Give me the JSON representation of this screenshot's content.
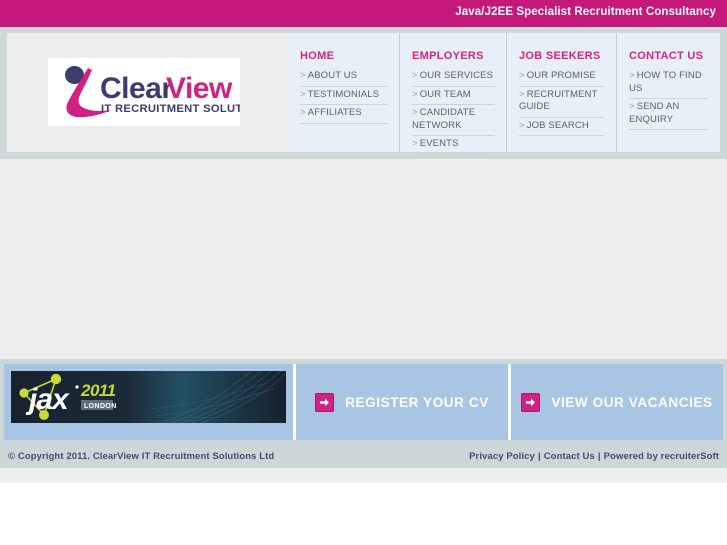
{
  "topbar": {
    "tagline": "Java/J2EE Specialist Recruitment Consultancy",
    "background_color": "#c4197a",
    "text_color": "#ffffff"
  },
  "logo": {
    "name": "clearview-logo",
    "text_clear": "Clear",
    "text_view": "View",
    "tagline": "IT RECRUITMENT SOLUTIONS",
    "color_dark": "#3c3c6e",
    "color_pink": "#cf2283"
  },
  "nav": {
    "columns": [
      {
        "title": "HOME",
        "items": [
          {
            "label": "ABOUT US"
          },
          {
            "label": "TESTIMONIALS"
          },
          {
            "label": "AFFILIATES"
          }
        ]
      },
      {
        "title": "EMPLOYERS",
        "items": [
          {
            "label": "OUR SERVICES"
          },
          {
            "label": "OUR TEAM"
          },
          {
            "label": "CANDIDATE NETWORK"
          },
          {
            "label": "EVENTS"
          }
        ]
      },
      {
        "title": "JOB SEEKERS",
        "items": [
          {
            "label": "OUR PROMISE"
          },
          {
            "label": "RECRUITMENT GUIDE"
          },
          {
            "label": "JOB SEARCH"
          }
        ]
      },
      {
        "title": "CONTACT US",
        "items": [
          {
            "label": "HOW TO FIND US"
          },
          {
            "label": "SEND AN ENQUIRY"
          }
        ]
      }
    ],
    "bullet": ">",
    "title_color": "#d8227f",
    "background_color": "#e8eff9"
  },
  "banner": {
    "jax": {
      "name": "jax-2011-london-banner",
      "text_jax": "jax",
      "text_year": "2011",
      "text_city": "LONDON"
    },
    "ctas": [
      {
        "label": "REGISTER YOUR CV",
        "icon": "arrow-right-icon"
      },
      {
        "label": "VIEW OUR VACANCIES",
        "icon": "arrow-right-icon"
      }
    ],
    "cta_background": "#a8c6e4",
    "cta_accent": "#cf2283"
  },
  "footer": {
    "copyright": "© Copyright 2011. ClearView IT Recruitment Solutions Ltd",
    "links": [
      {
        "label": "Privacy Policy"
      },
      {
        "label": "Contact Us"
      },
      {
        "label": "Powered by recruiterSoft"
      }
    ],
    "separator": "|",
    "text_color": "#434b7a",
    "background_color": "#cdd7d7"
  }
}
